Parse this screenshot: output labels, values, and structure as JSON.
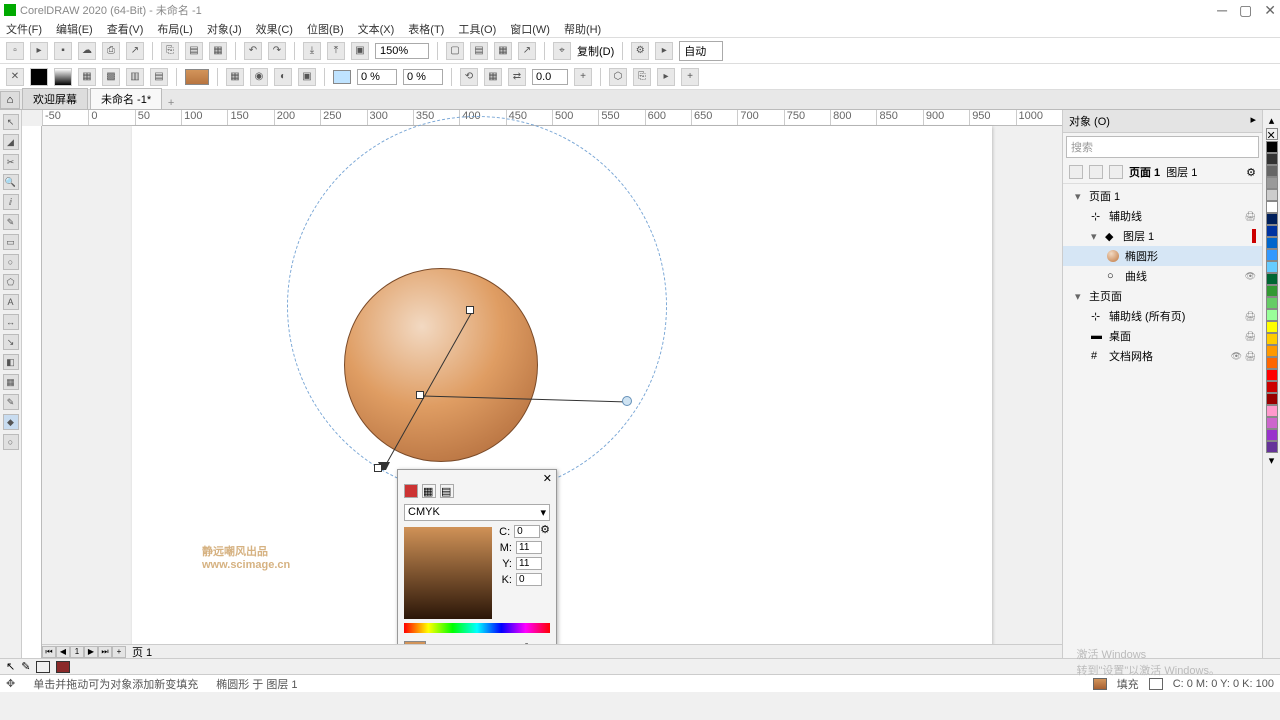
{
  "app": {
    "title": "CorelDRAW 2020 (64-Bit) - 未命名 -1"
  },
  "menu": [
    "文件(F)",
    "编辑(E)",
    "查看(V)",
    "布局(L)",
    "对象(J)",
    "效果(C)",
    "位图(B)",
    "文本(X)",
    "表格(T)",
    "工具(O)",
    "窗口(W)",
    "帮助(H)"
  ],
  "toolbar": {
    "zoom": "150%",
    "auto": "自动",
    "copy": "复制(D)",
    "pct1": "0 %",
    "pct2": "0 %",
    "rot": "0.0"
  },
  "tabs": {
    "welcome": "欢迎屏幕",
    "doc": "未命名 -1*"
  },
  "ruler_h": [
    "-50",
    "0",
    "50",
    "100",
    "150",
    "200",
    "250",
    "300",
    "350",
    "400",
    "450",
    "500",
    "550",
    "600",
    "650",
    "700",
    "750",
    "800",
    "850",
    "900",
    "950",
    "1000"
  ],
  "watermark": {
    "l1": "静远嘲风出品",
    "l2": "www.scimage.cn"
  },
  "colordlg": {
    "model": "CMYK",
    "c_label": "C:",
    "m_label": "M:",
    "y_label": "Y:",
    "k_label": "K:",
    "c": "0",
    "m": "11",
    "y": "11",
    "k": "0"
  },
  "docker": {
    "title": "对象 (O)",
    "search": "搜索",
    "page": "页面 1",
    "layer": "图层 1",
    "tree": {
      "page1": "页面 1",
      "guides": "辅助线",
      "layer1": "图层 1",
      "ellipse": "椭圆形",
      "curve": "曲线",
      "master": "主页面",
      "guides_all": "辅助线 (所有页)",
      "desktop": "桌面",
      "grid": "文档网格"
    }
  },
  "palette": [
    "#000000",
    "#333333",
    "#666666",
    "#999999",
    "#cccccc",
    "#ffffff",
    "#001f5b",
    "#0033a0",
    "#0066cc",
    "#3399ff",
    "#66ccff",
    "#006633",
    "#339933",
    "#66cc66",
    "#99ff99",
    "#ffff00",
    "#ffcc00",
    "#ff9900",
    "#ff6600",
    "#ff0000",
    "#cc0000",
    "#990000",
    "#ff99cc",
    "#cc66cc",
    "#9933cc",
    "#663399"
  ],
  "pagebar": {
    "page1": "页 1"
  },
  "status": {
    "hint": "单击并拖动可为对象添加新变填充",
    "sel": "椭圆形 于 图层 1",
    "fill_label": "填充",
    "cmyk": "C: 0 M: 0 Y: 0 K: 100"
  },
  "activate": {
    "l1": "激活 Windows",
    "l2": "转到\"设置\"以激活 Windows。"
  }
}
